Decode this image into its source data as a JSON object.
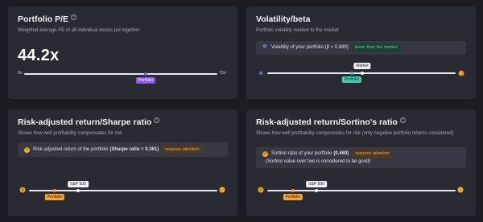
{
  "pe_card": {
    "title": "Portfolio P/E",
    "subtitle": "Weighted average PE of all individual stocks put together",
    "value": "44.2x",
    "scale_min_label": "0x",
    "scale_max_label": "70x",
    "portfolio_tag": "Portfolio",
    "portfolio_position_fraction": 0.63
  },
  "volatility_card": {
    "title": "Volatility/beta",
    "subtitle": "Portfolio volatility relative to the market",
    "info_text": "Volatility of your portfolio (β = 0.889)",
    "info_badge": "lower than the market",
    "market_tag": "Market",
    "portfolio_tag": "Portfolio",
    "market_position_fraction": 0.51,
    "portfolio_position_fraction": 0.46
  },
  "sharpe_card": {
    "title": "Risk-adjusted return/Sharpe ratio",
    "subtitle": "Shows how well profitability compensates for risk",
    "info_text_prefix": "Risk-adjusted return of the portfolio",
    "info_text_bold": "(Sharpe ratio = 0.361)",
    "info_badge": "requires attention",
    "benchmark_tag": "S&P 500",
    "portfolio_tag": "Portfolio",
    "benchmark_position_fraction": 0.28,
    "portfolio_position_fraction": 0.15
  },
  "sortino_card": {
    "title": "Risk-adjusted return/Sortino's ratio",
    "subtitle": "Shows how well profitability compensates for risk (only negative portfolio returns considered)",
    "info_text_prefix": "Sortino ratio of your portfolio",
    "info_text_bold": "(0.469)",
    "info_badge": "requires attention",
    "info_text_suffix": "(Sortino value over two is considered to be good)",
    "benchmark_tag": "S&P 500",
    "portfolio_tag": "Portfolio",
    "benchmark_position_fraction": 0.28,
    "portfolio_position_fraction": 0.15
  },
  "colors": {
    "background": "#1c1c22",
    "card": "#2a2a33",
    "pe_marker": "#8a5cf6",
    "volatility_marker": "#3fcfb0",
    "attention": "#f2a33a",
    "good": "#4fd6a4"
  },
  "icons": {
    "info": "info-icon",
    "smile": "smile-emoji-icon",
    "frown": "frown-emoji-icon",
    "fire": "fire-icon",
    "snow": "snowflake-icon"
  }
}
